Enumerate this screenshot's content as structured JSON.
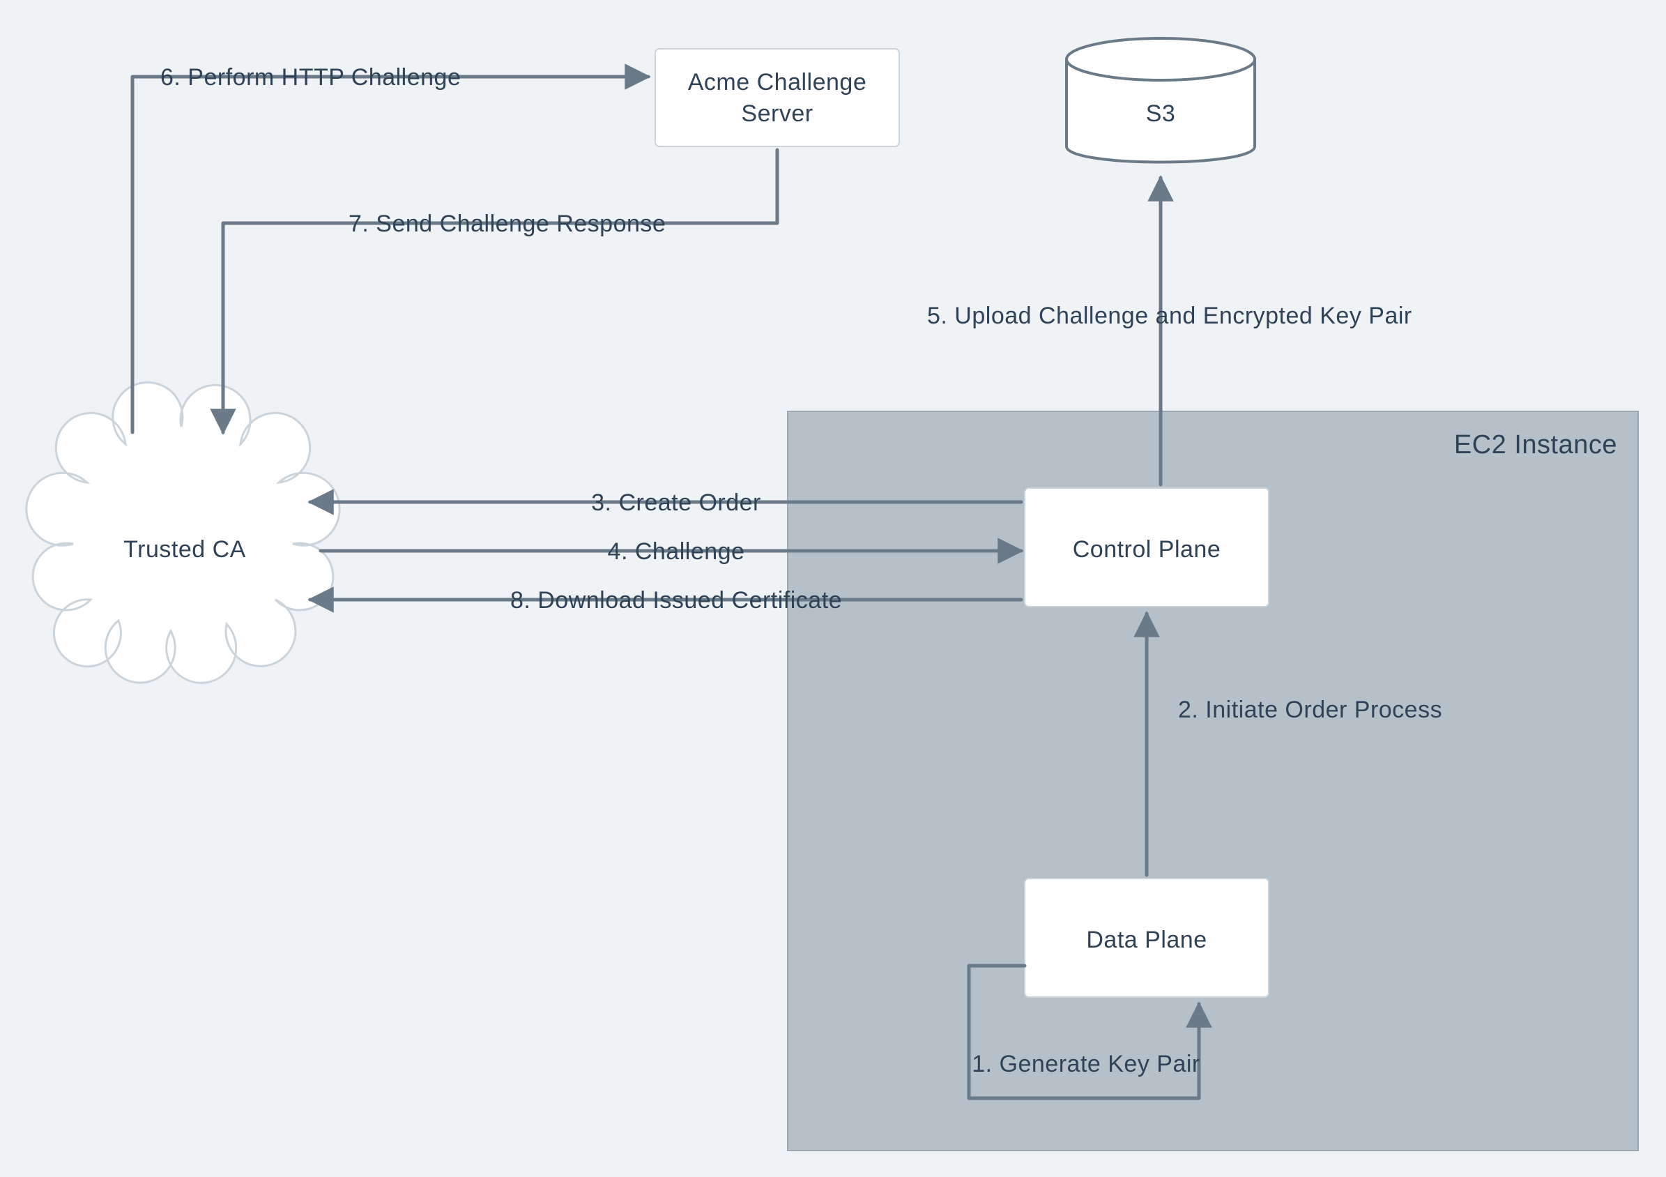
{
  "nodes": {
    "acme": {
      "line1": "Acme Challenge",
      "line2": "Server"
    },
    "s3": "S3",
    "trustedCA": "Trusted CA",
    "controlPlane": "Control Plane",
    "dataPlane": "Data Plane",
    "ec2": "EC2 Instance"
  },
  "steps": {
    "s1": "1.  Generate Key Pair",
    "s2": "2.  Initiate Order Process",
    "s3": "3.  Create Order",
    "s4": "4.  Challenge",
    "s5": "5.  Upload  Challenge and Encrypted Key Pair",
    "s6": "6.  Perform HTTP Challenge",
    "s7": "7.  Send Challenge Response",
    "s8": "8.  Download Issued Certificate"
  }
}
